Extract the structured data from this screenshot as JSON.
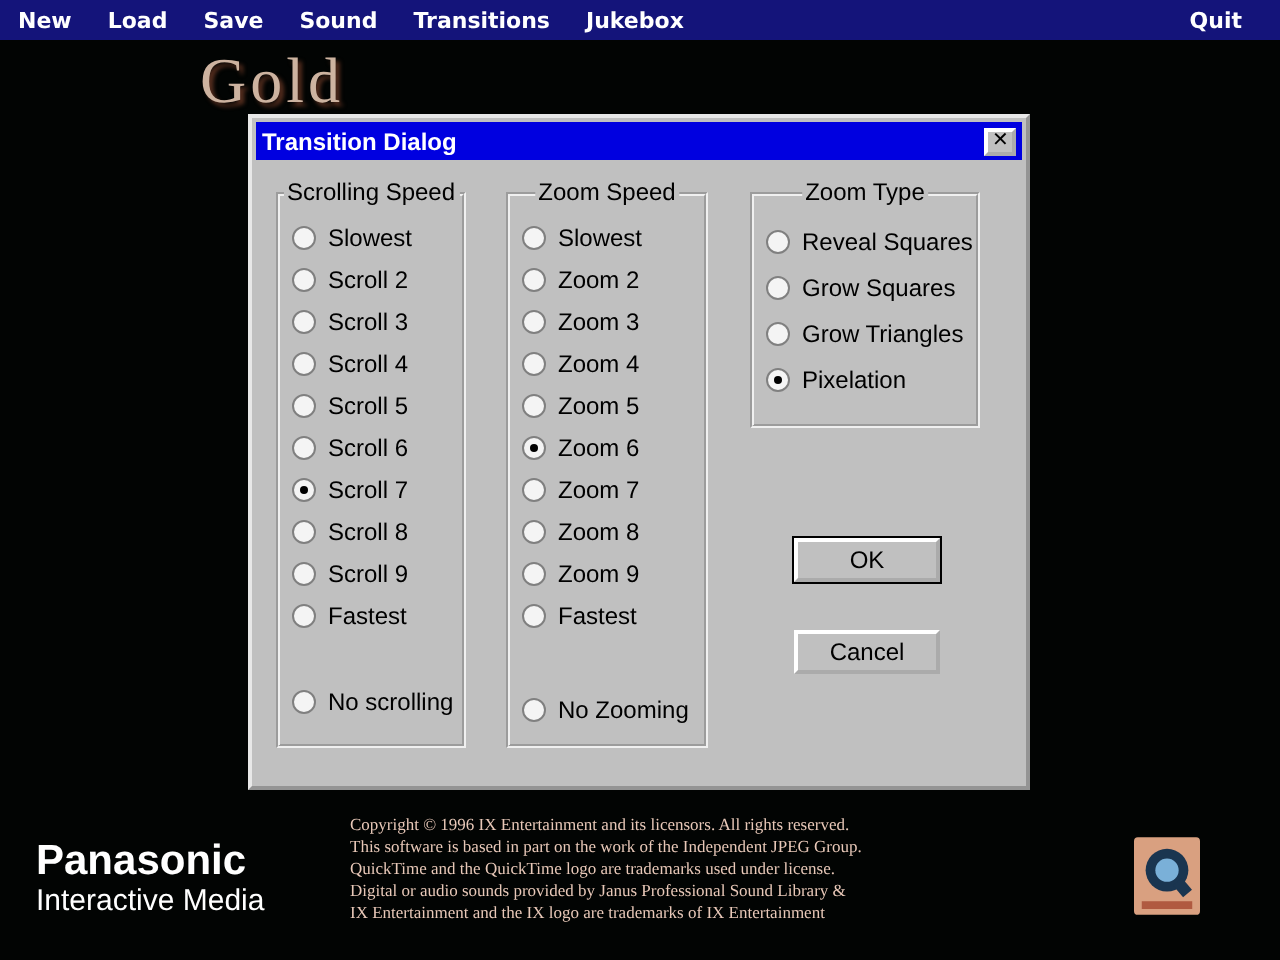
{
  "menu": [
    {
      "label": "New"
    },
    {
      "label": "Load"
    },
    {
      "label": "Save"
    },
    {
      "label": "Sound"
    },
    {
      "label": "Transitions"
    },
    {
      "label": "Jukebox"
    }
  ],
  "menu_right": {
    "label": "Quit"
  },
  "backdrop_title": "Gold",
  "dialog": {
    "title": "Transition Dialog",
    "close": "✕",
    "groups": [
      {
        "title": "Scrolling Speed",
        "options": [
          {
            "label": "Slowest",
            "selected": false
          },
          {
            "label": "Scroll 2",
            "selected": false
          },
          {
            "label": "Scroll 3",
            "selected": false
          },
          {
            "label": "Scroll 4",
            "selected": false
          },
          {
            "label": "Scroll 5",
            "selected": false
          },
          {
            "label": "Scroll 6",
            "selected": false
          },
          {
            "label": "Scroll 7",
            "selected": true
          },
          {
            "label": "Scroll 8",
            "selected": false
          },
          {
            "label": "Scroll 9",
            "selected": false
          },
          {
            "label": "Fastest",
            "selected": false
          }
        ],
        "extra": {
          "label": "No scrolling",
          "selected": false
        }
      },
      {
        "title": "Zoom Speed",
        "options": [
          {
            "label": "Slowest",
            "selected": false
          },
          {
            "label": "Zoom 2",
            "selected": false
          },
          {
            "label": "Zoom 3",
            "selected": false
          },
          {
            "label": "Zoom 4",
            "selected": false
          },
          {
            "label": "Zoom 5",
            "selected": false
          },
          {
            "label": "Zoom 6",
            "selected": true
          },
          {
            "label": "Zoom 7",
            "selected": false
          },
          {
            "label": "Zoom 8",
            "selected": false
          },
          {
            "label": "Zoom 9",
            "selected": false
          },
          {
            "label": "Fastest",
            "selected": false
          }
        ],
        "extra": {
          "label": "No Zooming",
          "selected": false
        }
      },
      {
        "title": "Zoom Type",
        "options": [
          {
            "label": "Reveal Squares",
            "selected": false
          },
          {
            "label": "Grow Squares",
            "selected": false
          },
          {
            "label": "Grow Triangles",
            "selected": false
          },
          {
            "label": "Pixelation",
            "selected": true
          }
        ]
      }
    ],
    "buttons": [
      {
        "label": "OK",
        "default": true
      },
      {
        "label": "Cancel",
        "default": false
      }
    ]
  },
  "brand": {
    "name": "Panasonic",
    "subtitle": "Interactive Media"
  },
  "copyright": [
    "Copyright © 1996 IX Entertainment and its licensors. All rights reserved.",
    "This software is based in part on the work of the Independent JPEG Group.",
    "QuickTime and the QuickTime logo are trademarks used under license.",
    "Digital or audio sounds provided by Janus Professional Sound Library &",
    "IX Entertainment and the IX logo are trademarks of IX Entertainment"
  ]
}
